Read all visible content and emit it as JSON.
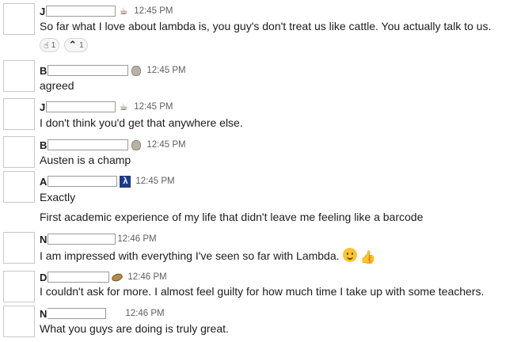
{
  "messages": [
    {
      "initial": "J",
      "status_icon": "coffee-cup-icon",
      "time": "12:45 PM",
      "lines": [
        "So far what I love about lambda is, you guy's don't treat us like cattle.  You actually talk to us."
      ],
      "reactions": [
        {
          "icon": "point-up-icon",
          "glyph": "☝",
          "count": "1"
        },
        {
          "icon": "caret-up-icon",
          "glyph": "⌃",
          "count": "1"
        }
      ]
    },
    {
      "initial": "B",
      "status_icon": "owl-icon",
      "time": "12:45 PM",
      "lines": [
        "agreed"
      ]
    },
    {
      "initial": "J",
      "status_icon": "coffee-cup-icon",
      "time": "12:45 PM",
      "lines": [
        "I don't think you'd get that anywhere else."
      ]
    },
    {
      "initial": "B",
      "status_icon": "owl-icon",
      "time": "12:45 PM",
      "lines": [
        "Austen is a champ"
      ]
    },
    {
      "initial": "A",
      "status_icon": "lambda-school-icon",
      "status_glyph": "λ",
      "time": "12:45 PM",
      "lines": [
        "Exactly",
        "First academic experience of my life that didn't leave me feeling like a barcode"
      ]
    },
    {
      "initial": "N",
      "time": "12:46 PM",
      "lines": [
        "I am impressed with everything I've seen so far with Lambda."
      ],
      "emojis": [
        "slightly-smiling-face-icon",
        "thumbs-up-icon"
      ]
    },
    {
      "initial": "D",
      "status_icon": "potato-icon",
      "time": "12:46 PM",
      "lines": [
        "I couldn't ask for more.  I almost feel guilty for how much time I take up with some teachers."
      ]
    },
    {
      "initial": "N",
      "time": "12:46 PM",
      "lines": [
        "What you guys are doing is truly great."
      ]
    }
  ]
}
